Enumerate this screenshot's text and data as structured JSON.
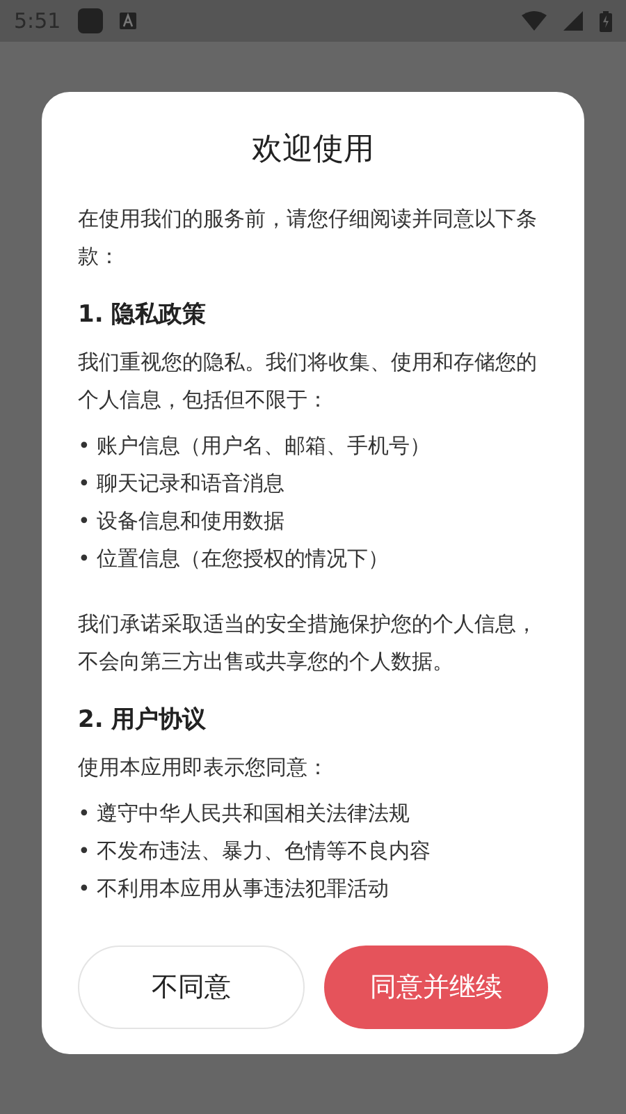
{
  "status_bar": {
    "time": "5:51"
  },
  "dialog": {
    "title": "欢迎使用",
    "blocks": [
      {
        "kind": "paragraph",
        "text": "在使用我们的服务前，请您仔细阅读并同意以下条款："
      },
      {
        "kind": "heading",
        "text": "1. 隐私政策"
      },
      {
        "kind": "paragraph",
        "text": "我们重视您的隐私。我们将收集、使用和存储您的个人信息，包括但不限于："
      },
      {
        "kind": "bullet",
        "text": "• 账户信息（用户名、邮箱、手机号）"
      },
      {
        "kind": "bullet",
        "text": "• 聊天记录和语音消息"
      },
      {
        "kind": "bullet",
        "text": "• 设备信息和使用数据"
      },
      {
        "kind": "bullet",
        "text": "• 位置信息（在您授权的情况下）"
      },
      {
        "kind": "paragraph",
        "text": "我们承诺采取适当的安全措施保护您的个人信息，不会向第三方出售或共享您的个人数据。"
      },
      {
        "kind": "heading",
        "text": "2. 用户协议"
      },
      {
        "kind": "paragraph",
        "text": "使用本应用即表示您同意："
      },
      {
        "kind": "bullet",
        "text": "• 遵守中华人民共和国相关法律法规"
      },
      {
        "kind": "bullet",
        "text": "• 不发布违法、暴力、色情等不良内容"
      },
      {
        "kind": "bullet",
        "text": "• 不利用本应用从事违法犯罪活动"
      }
    ],
    "buttons": [
      {
        "label": "不同意",
        "kind": "secondary"
      },
      {
        "label": "同意并继续",
        "kind": "primary"
      }
    ]
  }
}
